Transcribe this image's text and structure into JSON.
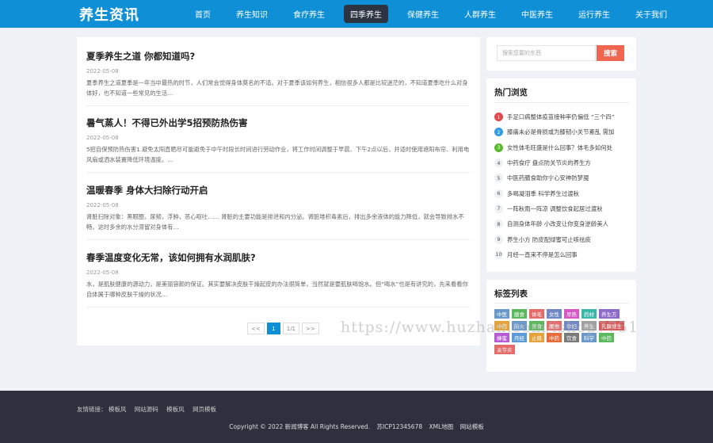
{
  "header": {
    "logo": "养生资讯",
    "nav": [
      "首页",
      "养生知识",
      "食疗养生",
      "四季养生",
      "保健养生",
      "人群养生",
      "中医养生",
      "运行养生",
      "关于我们"
    ]
  },
  "articles": [
    {
      "title": "夏季养生之道 你都知道吗?",
      "date": "2022-05-08",
      "summary": "夏季养生之道夏季是一年当中最热的时节，人们常会觉得身体莫名的不适。对于夏季该如何养生，相信很多人都是比较迷茫的，不知道夏季吃什么对身体好，也不知道一些常见的生活…"
    },
    {
      "title": "暑气蒸人！不得已外出学5招预防热伤害",
      "date": "2022-05-08",
      "summary": "5招自保预防热伤害1.避免太阳直晒尽可能避免于中午时段长时间进行劳动作业，将工作时间调整于早晨、下午2点以后，并适时使用遮阳布帘、利用电风扇或洒水装置降低环境温度。…"
    },
    {
      "title": "温暖春季 身体大扫除行动开启",
      "date": "2022-05-08",
      "summary": "肾脏扫除对象：黑眼圈，尿频，浮肿，恶心呕吐…… 肾脏的主要功能是排泄和内分泌。肾脏堆积毒素后，排出多余液体的能力降低，就会导致排水不畅，这时多余的水分滞留对身体有…"
    },
    {
      "title": "春季温度变化无常，该如何拥有水润肌肤?",
      "date": "2022-05-08",
      "summary": "水，是肌肤健康的源动力，是美丽容颜的保证。其实要解决皮肤干燥起皮的办法很简单，当然就是要肌肤喝饱水。但“喝水”也是有讲究的，先来看看你自体属于哪种皮肤干燥的状况…"
    }
  ],
  "pager": {
    "prev": "<<",
    "current": "1",
    "total": "1/1",
    "next": ">>"
  },
  "search": {
    "placeholder": "搜索您要的东西",
    "button": "搜索"
  },
  "hot": {
    "title": "热门浏览",
    "items": [
      {
        "rank": "1",
        "text": "手足口病整体疫苗接种率仍偏低 “三个四”"
      },
      {
        "rank": "2",
        "text": "膝痛未必是骨损或为膝韧小关节紊乱 需加"
      },
      {
        "rank": "3",
        "text": "女性体毛旺盛是什么回事？体毛多如何处"
      },
      {
        "rank": "4",
        "text": "中药食疗 盘点防关节炎的养生方"
      },
      {
        "rank": "5",
        "text": "中医药膳食助你宁心安神防梦魇"
      },
      {
        "rank": "6",
        "text": "多喝凝泪季 科学养生过渡秋"
      },
      {
        "rank": "7",
        "text": "一阵秋雨一阵凉 调整饮食起居过渡秋"
      },
      {
        "rank": "8",
        "text": "自测身体年龄 小改变让你变身逆龄美人"
      },
      {
        "rank": "9",
        "text": "养生小方 防皮配绿蜜可止咳祛痰"
      },
      {
        "rank": "10",
        "text": "月经一直来不停是怎么回事"
      }
    ]
  },
  "tags": {
    "title": "标签列表",
    "items": [
      {
        "text": "中医",
        "color": "#6a98c9"
      },
      {
        "text": "膳食",
        "color": "#5cb85c"
      },
      {
        "text": "体毛",
        "color": "#e56b6b"
      },
      {
        "text": "女性",
        "color": "#6f88c4"
      },
      {
        "text": "早熟",
        "color": "#d558c6"
      },
      {
        "text": "药材",
        "color": "#3bb7a8"
      },
      {
        "text": "养生方",
        "color": "#8c6bc8"
      },
      {
        "text": "中药",
        "color": "#e3a33a"
      },
      {
        "text": "防火",
        "color": "#6a98c9"
      },
      {
        "text": "美食",
        "color": "#5cb85c"
      },
      {
        "text": "腰椎",
        "color": "#e56b6b"
      },
      {
        "text": "孕妇",
        "color": "#6f88c4"
      },
      {
        "text": "养生",
        "color": "#a0a0a0"
      },
      {
        "text": "乳腺增生",
        "color": "#d55b5b"
      },
      {
        "text": "蜂蜜",
        "color": "#b55bd5"
      },
      {
        "text": "月经",
        "color": "#5c9bd5"
      },
      {
        "text": "止咳",
        "color": "#e3a33a"
      },
      {
        "text": "中药",
        "color": "#e56b3a"
      },
      {
        "text": "饮食",
        "color": "#7a7a7a"
      },
      {
        "text": "科学",
        "color": "#6a98c9"
      },
      {
        "text": "中药",
        "color": "#5cb85c"
      },
      {
        "text": "关节炎",
        "color": "#e56b6b"
      }
    ]
  },
  "footer": {
    "links_label": "友情链接：",
    "links": [
      "模板风",
      "网站源码",
      "模板风",
      "网页模板"
    ],
    "copyright": "Copyright © 2022 新闻博客 All Rights Reserved.",
    "icp": "苏ICP12345678",
    "sitemap": "XML地图",
    "site_template": "网站模板"
  },
  "watermark": "https://www.huzhan.com/ishop7751"
}
